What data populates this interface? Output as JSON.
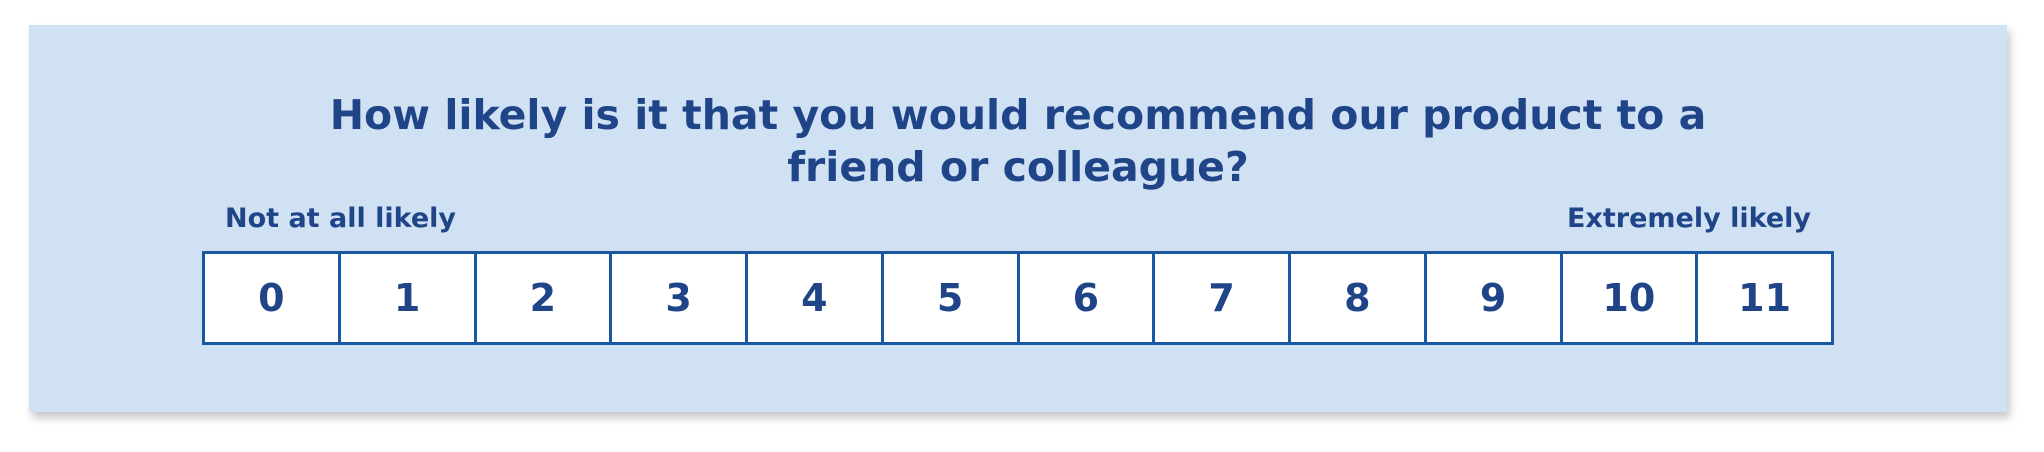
{
  "survey": {
    "question_line1": "How likely is it that you would recommend our product to a",
    "question_line2": "friend or colleague?",
    "label_low": "Not at all likely",
    "label_high": "Extremely likely",
    "options": [
      "0",
      "1",
      "2",
      "3",
      "4",
      "5",
      "6",
      "7",
      "8",
      "9",
      "10",
      "11"
    ]
  },
  "colors": {
    "background": "#cfe1f3",
    "text": "#1f4588",
    "border": "#1a58a1",
    "cell_fill": "#ffffff"
  }
}
